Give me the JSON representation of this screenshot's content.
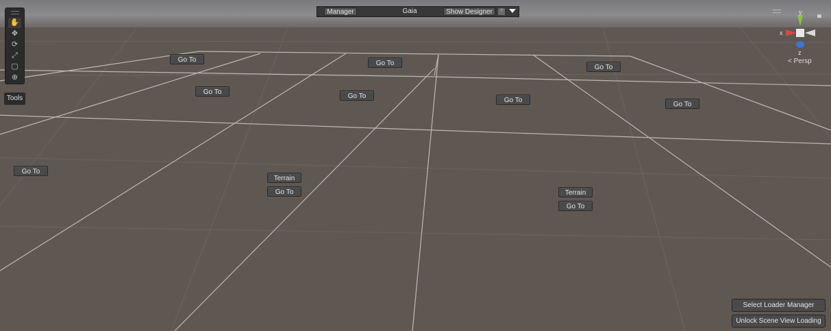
{
  "toolbar": {
    "tools": [
      {
        "name": "hand-tool",
        "glyph": "✋"
      },
      {
        "name": "move-tool",
        "glyph": "✥"
      },
      {
        "name": "rotate-tool",
        "glyph": "⟳"
      },
      {
        "name": "scale-tool",
        "glyph": "⤢"
      },
      {
        "name": "rect-tool",
        "glyph": "▢"
      },
      {
        "name": "transform-tool",
        "glyph": "⊕"
      }
    ],
    "tools_label": "Tools"
  },
  "topbar": {
    "manager_label": "Manager",
    "title": "Gaia",
    "show_designer_label": "Show Designer",
    "help_glyph": "?"
  },
  "gizmo": {
    "y_label": "y",
    "x_label": "x",
    "z_label": "z",
    "projection_label": "< Persp",
    "colors": {
      "x": "#d84a45",
      "y": "#86c43a",
      "z": "#3f73d8"
    }
  },
  "scene": {
    "goto_label": "Go To",
    "terrain_label": "Terrain"
  },
  "actions": {
    "select_loader_manager": "Select Loader Manager",
    "unlock_scene_view": "Unlock Scene View Loading"
  }
}
